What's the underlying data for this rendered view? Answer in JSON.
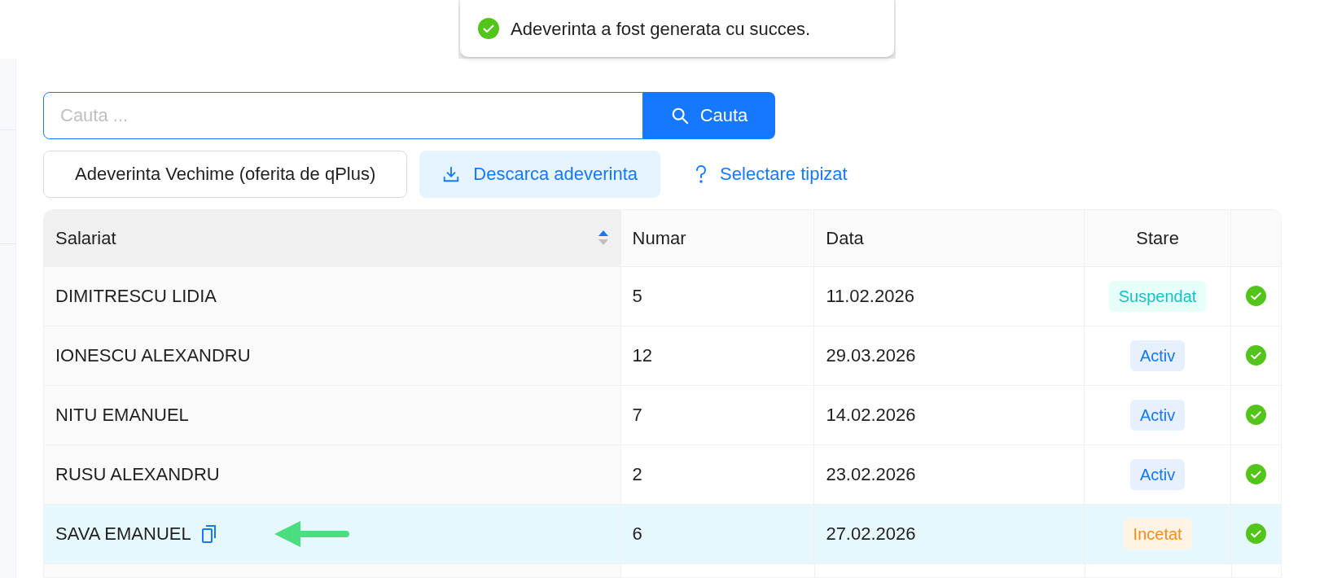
{
  "toast": {
    "message": "Adeverinta a fost generata cu succes."
  },
  "search": {
    "placeholder": "Cauta ...",
    "button": "Cauta"
  },
  "actions": [
    {
      "kind": "outline",
      "label": "Adeverinta Vechime (oferita de qPlus)"
    },
    {
      "kind": "download",
      "label": "Descarca adeverinta"
    },
    {
      "kind": "help",
      "label": "Selectare tipizat"
    }
  ],
  "table": {
    "columns": [
      {
        "label": "Salariat",
        "sorted_ascending": true
      },
      {
        "label": "Numar"
      },
      {
        "label": "Data"
      },
      {
        "label": "Stare"
      }
    ],
    "rows": [
      {
        "salariat": "DIMITRESCU LIDIA",
        "numar": "5",
        "data": "11.02.2026",
        "stare": {
          "label": "Suspendat",
          "kind": "suspended"
        },
        "selected": false,
        "copy_icon": false
      },
      {
        "salariat": "IONESCU ALEXANDRU",
        "numar": "12",
        "data": "29.03.2026",
        "stare": {
          "label": "Activ",
          "kind": "active"
        },
        "selected": false,
        "copy_icon": false
      },
      {
        "salariat": "NITU EMANUEL",
        "numar": "7",
        "data": "14.02.2026",
        "stare": {
          "label": "Activ",
          "kind": "active"
        },
        "selected": false,
        "copy_icon": false
      },
      {
        "salariat": "RUSU ALEXANDRU",
        "numar": "2",
        "data": "23.02.2026",
        "stare": {
          "label": "Activ",
          "kind": "active"
        },
        "selected": false,
        "copy_icon": false
      },
      {
        "salariat": "SAVA EMANUEL",
        "numar": "6",
        "data": "27.02.2026",
        "stare": {
          "label": "Incetat",
          "kind": "ended"
        },
        "selected": true,
        "copy_icon": true
      }
    ]
  }
}
